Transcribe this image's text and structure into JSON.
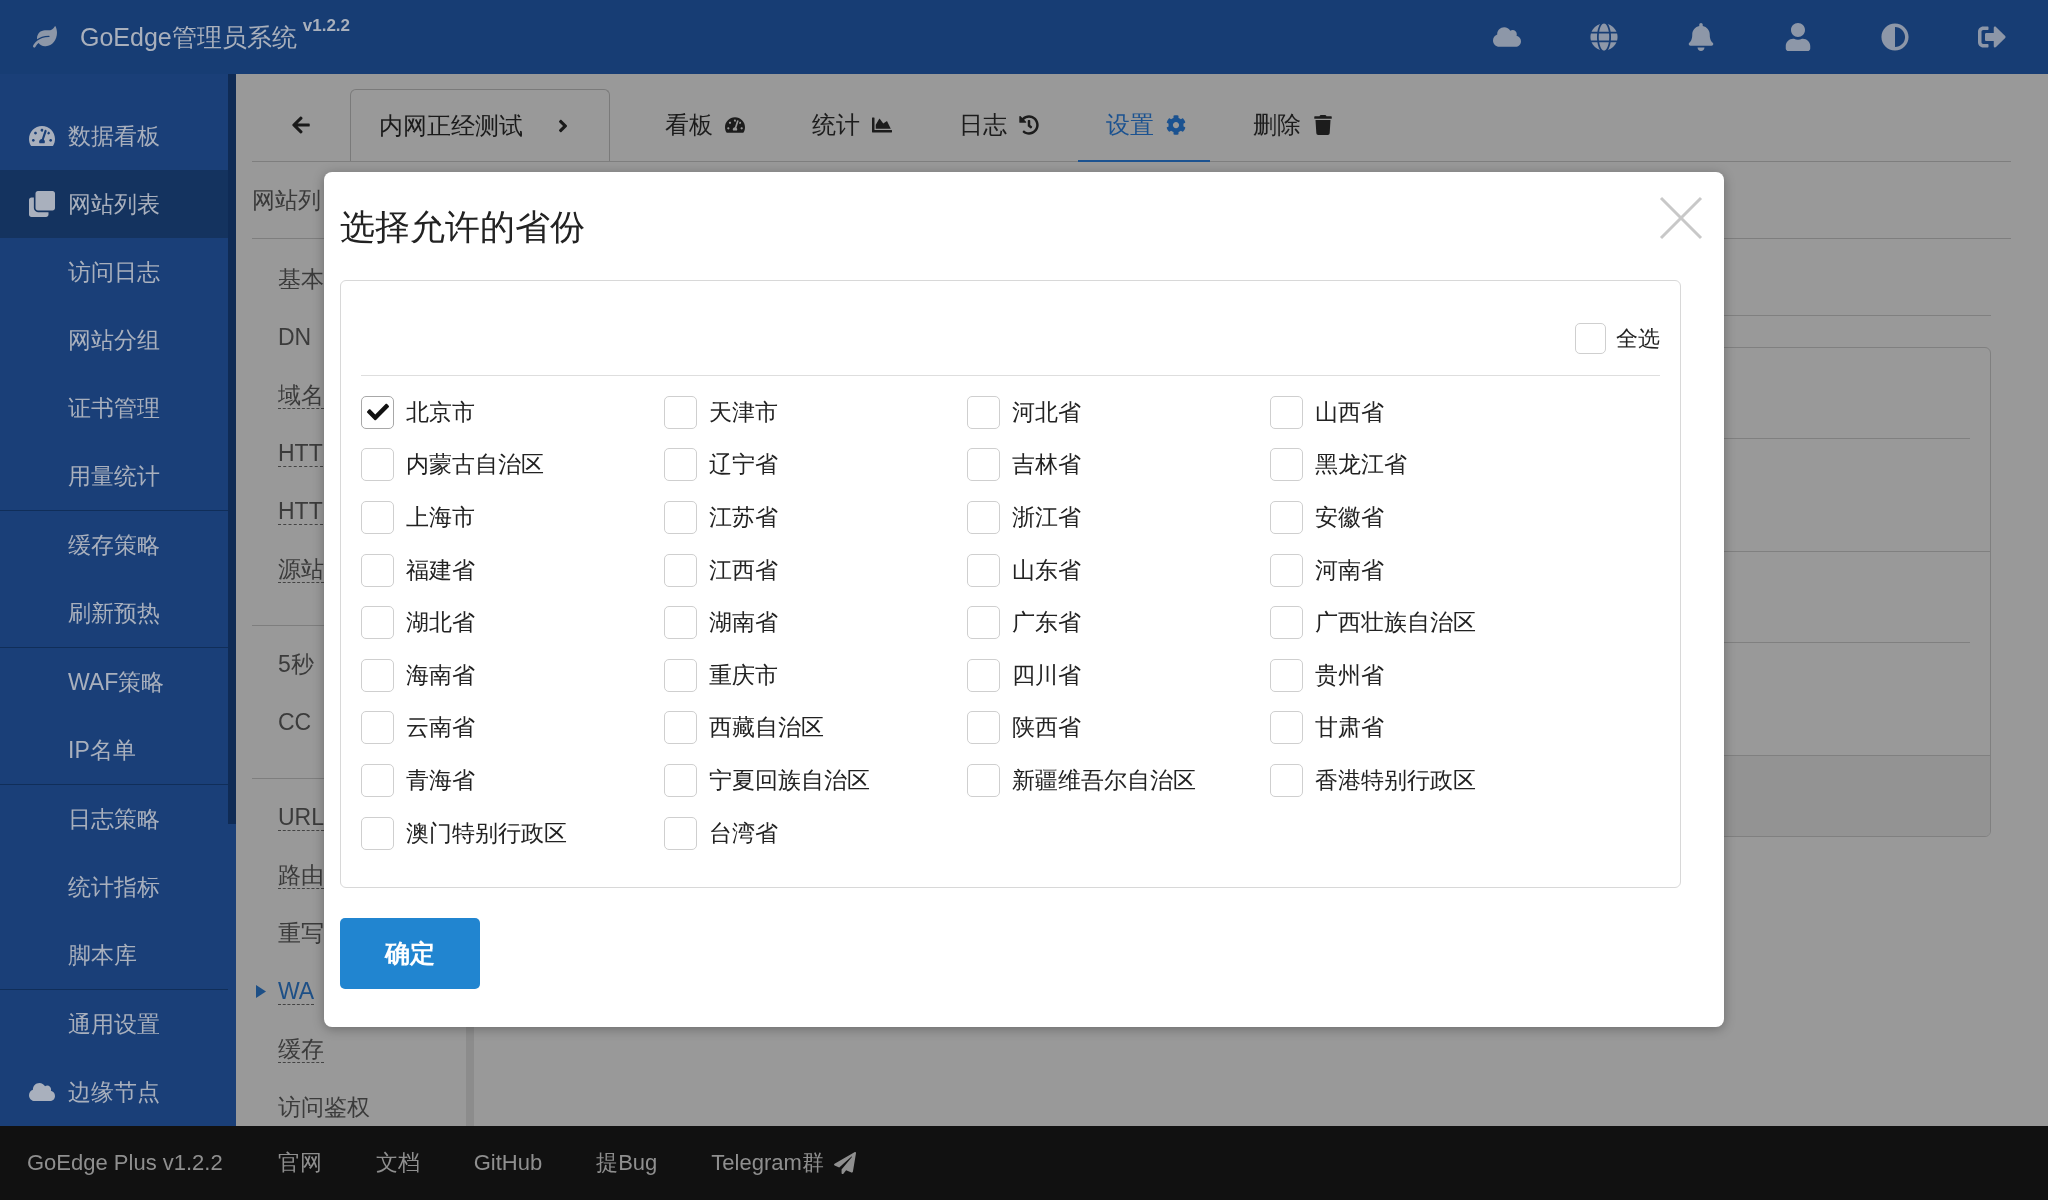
{
  "topbar": {
    "title": "GoEdge管理员系统",
    "version": "v1.2.2"
  },
  "sidebar": {
    "groups": [
      {
        "items": [
          {
            "label": "数据看板",
            "kind": "header",
            "selected": false
          },
          {
            "label": "网站列表",
            "kind": "header",
            "selected": true
          },
          {
            "label": "访问日志",
            "kind": "sub",
            "selected": false
          },
          {
            "label": "网站分组",
            "kind": "sub",
            "selected": false
          },
          {
            "label": "证书管理",
            "kind": "sub",
            "selected": false
          },
          {
            "label": "用量统计",
            "kind": "sub",
            "selected": false
          }
        ]
      },
      {
        "items": [
          {
            "label": "缓存策略",
            "kind": "sub",
            "selected": false
          },
          {
            "label": "刷新预热",
            "kind": "sub",
            "selected": false
          }
        ]
      },
      {
        "items": [
          {
            "label": "WAF策略",
            "kind": "sub",
            "selected": false
          },
          {
            "label": "IP名单",
            "kind": "sub",
            "selected": false
          }
        ]
      },
      {
        "items": [
          {
            "label": "日志策略",
            "kind": "sub",
            "selected": false
          },
          {
            "label": "统计指标",
            "kind": "sub",
            "selected": false
          },
          {
            "label": "脚本库",
            "kind": "sub",
            "selected": false
          }
        ]
      },
      {
        "items": [
          {
            "label": "通用设置",
            "kind": "sub",
            "selected": false
          },
          {
            "label": "边缘节点",
            "kind": "header",
            "selected": false
          }
        ]
      }
    ]
  },
  "tabs": {
    "items": [
      {
        "label": "内网正经测试",
        "kind": "server",
        "selected": false
      },
      {
        "label": "看板",
        "kind": "tab",
        "selected": false
      },
      {
        "label": "统计",
        "kind": "tab",
        "selected": false
      },
      {
        "label": "日志",
        "kind": "tab",
        "selected": false
      },
      {
        "label": "设置",
        "kind": "tab",
        "selected": true
      },
      {
        "label": "删除",
        "kind": "tab",
        "selected": false
      }
    ]
  },
  "breadcrumb": "网站列",
  "settings_menu": {
    "groups": [
      {
        "items": [
          {
            "label": "基本",
            "configured": false,
            "selected": false
          },
          {
            "label": "DN",
            "configured": false,
            "selected": false
          },
          {
            "label": "域名",
            "configured": true,
            "selected": false
          },
          {
            "label": "HTT",
            "configured": true,
            "selected": false
          },
          {
            "label": "HTT",
            "configured": true,
            "selected": false
          },
          {
            "label": "源站",
            "configured": true,
            "selected": false
          }
        ]
      },
      {
        "items": [
          {
            "label": "5秒",
            "configured": false,
            "selected": false
          },
          {
            "label": "CC",
            "configured": false,
            "selected": false
          }
        ]
      },
      {
        "items": [
          {
            "label": "URL",
            "configured": true,
            "selected": false
          },
          {
            "label": "路由",
            "configured": true,
            "selected": false
          },
          {
            "label": "重写",
            "configured": false,
            "selected": false
          },
          {
            "label": "WA",
            "configured": true,
            "selected": true
          },
          {
            "label": "缓存",
            "configured": true,
            "selected": false
          },
          {
            "label": "访问鉴权",
            "configured": false,
            "selected": false
          }
        ]
      }
    ]
  },
  "modal": {
    "title": "选择允许的省份",
    "select_all": {
      "label": "全选",
      "checked": false
    },
    "provinces": [
      {
        "label": "北京市",
        "checked": true
      },
      {
        "label": "天津市",
        "checked": false
      },
      {
        "label": "河北省",
        "checked": false
      },
      {
        "label": "山西省",
        "checked": false
      },
      {
        "label": "内蒙古自治区",
        "checked": false
      },
      {
        "label": "辽宁省",
        "checked": false
      },
      {
        "label": "吉林省",
        "checked": false
      },
      {
        "label": "黑龙江省",
        "checked": false
      },
      {
        "label": "上海市",
        "checked": false
      },
      {
        "label": "江苏省",
        "checked": false
      },
      {
        "label": "浙江省",
        "checked": false
      },
      {
        "label": "安徽省",
        "checked": false
      },
      {
        "label": "福建省",
        "checked": false
      },
      {
        "label": "江西省",
        "checked": false
      },
      {
        "label": "山东省",
        "checked": false
      },
      {
        "label": "河南省",
        "checked": false
      },
      {
        "label": "湖北省",
        "checked": false
      },
      {
        "label": "湖南省",
        "checked": false
      },
      {
        "label": "广东省",
        "checked": false
      },
      {
        "label": "广西壮族自治区",
        "checked": false
      },
      {
        "label": "海南省",
        "checked": false
      },
      {
        "label": "重庆市",
        "checked": false
      },
      {
        "label": "四川省",
        "checked": false
      },
      {
        "label": "贵州省",
        "checked": false
      },
      {
        "label": "云南省",
        "checked": false
      },
      {
        "label": "西藏自治区",
        "checked": false
      },
      {
        "label": "陕西省",
        "checked": false
      },
      {
        "label": "甘肃省",
        "checked": false
      },
      {
        "label": "青海省",
        "checked": false
      },
      {
        "label": "宁夏回族自治区",
        "checked": false
      },
      {
        "label": "新疆维吾尔自治区",
        "checked": false
      },
      {
        "label": "香港特别行政区",
        "checked": false
      },
      {
        "label": "澳门特别行政区",
        "checked": false
      },
      {
        "label": "台湾省",
        "checked": false
      }
    ],
    "confirm_button": "确定"
  },
  "footer": {
    "version": "GoEdge Plus v1.2.2",
    "links": [
      "官网",
      "文档",
      "GitHub",
      "提Bug",
      "Telegram群"
    ]
  }
}
